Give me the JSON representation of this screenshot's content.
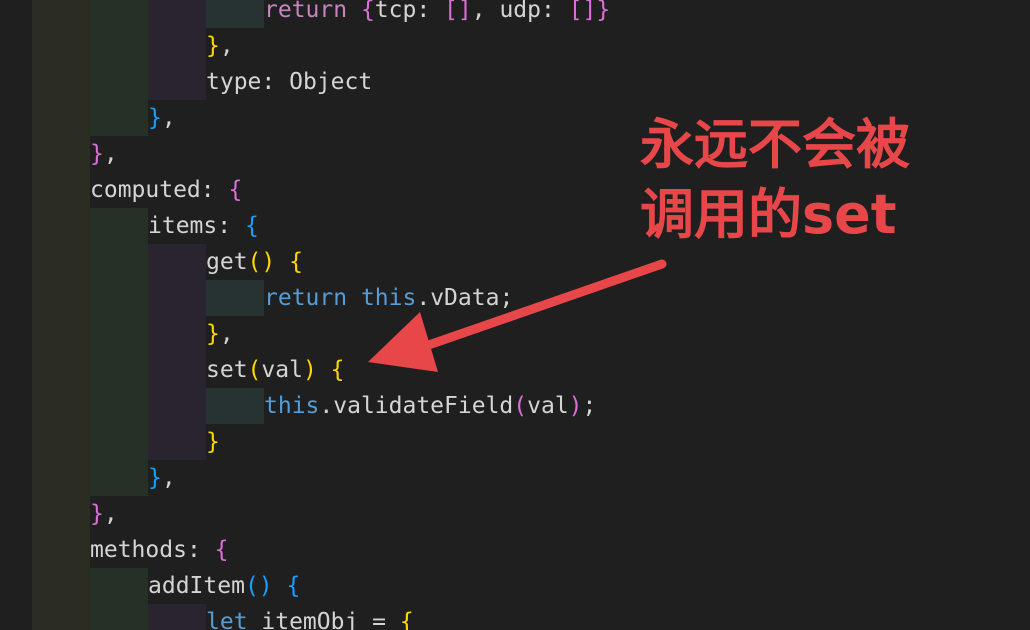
{
  "colors": {
    "background": "#1f1f1f",
    "guide_outer": "#2c2d22",
    "guide_level1": "#253026",
    "guide_level2": "#2a2330",
    "guide_level3": "#273233",
    "annotation": "#e8474a"
  },
  "lines": [
    {
      "indent": 3,
      "tokens": [
        {
          "text": "return ",
          "color": "#c586c0"
        },
        {
          "text": "{",
          "color": "#da70d6"
        },
        {
          "text": "tcp",
          "color": "#d4d4d4"
        },
        {
          "text": ": ",
          "color": "#d4d4d4"
        },
        {
          "text": "[]",
          "color": "#da70d6"
        },
        {
          "text": ", ",
          "color": "#d4d4d4"
        },
        {
          "text": "udp",
          "color": "#d4d4d4"
        },
        {
          "text": ": ",
          "color": "#d4d4d4"
        },
        {
          "text": "[]",
          "color": "#da70d6"
        },
        {
          "text": "}",
          "color": "#da70d6"
        }
      ]
    },
    {
      "indent": 2,
      "tokens": [
        {
          "text": "}",
          "color": "#ffd700"
        },
        {
          "text": ",",
          "color": "#d4d4d4"
        }
      ]
    },
    {
      "indent": 2,
      "tokens": [
        {
          "text": "type",
          "color": "#d4d4d4"
        },
        {
          "text": ": ",
          "color": "#d4d4d4"
        },
        {
          "text": "Object",
          "color": "#d4d4d4"
        }
      ]
    },
    {
      "indent": 1,
      "tokens": [
        {
          "text": "}",
          "color": "#179fff"
        },
        {
          "text": ",",
          "color": "#d4d4d4"
        }
      ]
    },
    {
      "indent": 0,
      "tokens": [
        {
          "text": "}",
          "color": "#da70d6"
        },
        {
          "text": ",",
          "color": "#d4d4d4"
        }
      ]
    },
    {
      "indent": 0,
      "tokens": [
        {
          "text": "computed",
          "color": "#d4d4d4"
        },
        {
          "text": ": ",
          "color": "#d4d4d4"
        },
        {
          "text": "{",
          "color": "#da70d6"
        }
      ]
    },
    {
      "indent": 1,
      "tokens": [
        {
          "text": "items",
          "color": "#d4d4d4"
        },
        {
          "text": ": ",
          "color": "#d4d4d4"
        },
        {
          "text": "{",
          "color": "#179fff"
        }
      ]
    },
    {
      "indent": 2,
      "tokens": [
        {
          "text": "get",
          "color": "#d4d4d4"
        },
        {
          "text": "()",
          "color": "#ffd700"
        },
        {
          "text": " ",
          "color": "#d4d4d4"
        },
        {
          "text": "{",
          "color": "#ffd700"
        }
      ]
    },
    {
      "indent": 3,
      "tokens": [
        {
          "text": "return ",
          "color": "#569cd6"
        },
        {
          "text": "this",
          "color": "#569cd6"
        },
        {
          "text": ".",
          "color": "#d4d4d4"
        },
        {
          "text": "vData",
          "color": "#d4d4d4"
        },
        {
          "text": ";",
          "color": "#d4d4d4"
        }
      ]
    },
    {
      "indent": 2,
      "tokens": [
        {
          "text": "}",
          "color": "#ffd700"
        },
        {
          "text": ",",
          "color": "#d4d4d4"
        }
      ]
    },
    {
      "indent": 2,
      "tokens": [
        {
          "text": "set",
          "color": "#d4d4d4"
        },
        {
          "text": "(",
          "color": "#ffd700"
        },
        {
          "text": "val",
          "color": "#d4d4d4"
        },
        {
          "text": ")",
          "color": "#ffd700"
        },
        {
          "text": " ",
          "color": "#d4d4d4"
        },
        {
          "text": "{",
          "color": "#ffd700"
        }
      ]
    },
    {
      "indent": 3,
      "tokens": [
        {
          "text": "this",
          "color": "#569cd6"
        },
        {
          "text": ".",
          "color": "#d4d4d4"
        },
        {
          "text": "validateField",
          "color": "#d4d4d4"
        },
        {
          "text": "(",
          "color": "#da70d6"
        },
        {
          "text": "val",
          "color": "#d4d4d4"
        },
        {
          "text": ")",
          "color": "#da70d6"
        },
        {
          "text": ";",
          "color": "#d4d4d4"
        }
      ]
    },
    {
      "indent": 2,
      "tokens": [
        {
          "text": "}",
          "color": "#ffd700"
        }
      ]
    },
    {
      "indent": 1,
      "tokens": [
        {
          "text": "}",
          "color": "#179fff"
        },
        {
          "text": ",",
          "color": "#d4d4d4"
        }
      ]
    },
    {
      "indent": 0,
      "tokens": [
        {
          "text": "}",
          "color": "#da70d6"
        },
        {
          "text": ",",
          "color": "#d4d4d4"
        }
      ]
    },
    {
      "indent": 0,
      "tokens": [
        {
          "text": "methods",
          "color": "#d4d4d4"
        },
        {
          "text": ": ",
          "color": "#d4d4d4"
        },
        {
          "text": "{",
          "color": "#da70d6"
        }
      ]
    },
    {
      "indent": 1,
      "tokens": [
        {
          "text": "addItem",
          "color": "#d4d4d4"
        },
        {
          "text": "()",
          "color": "#179fff"
        },
        {
          "text": " ",
          "color": "#d4d4d4"
        },
        {
          "text": "{",
          "color": "#179fff"
        }
      ]
    },
    {
      "indent": 2,
      "tokens": [
        {
          "text": "let ",
          "color": "#569cd6"
        },
        {
          "text": "itemObj",
          "color": "#d4d4d4"
        },
        {
          "text": " = ",
          "color": "#d4d4d4"
        },
        {
          "text": "{",
          "color": "#ffd700"
        }
      ]
    }
  ],
  "annotation": {
    "line1": "永远不会被",
    "line2": "调用的set"
  }
}
